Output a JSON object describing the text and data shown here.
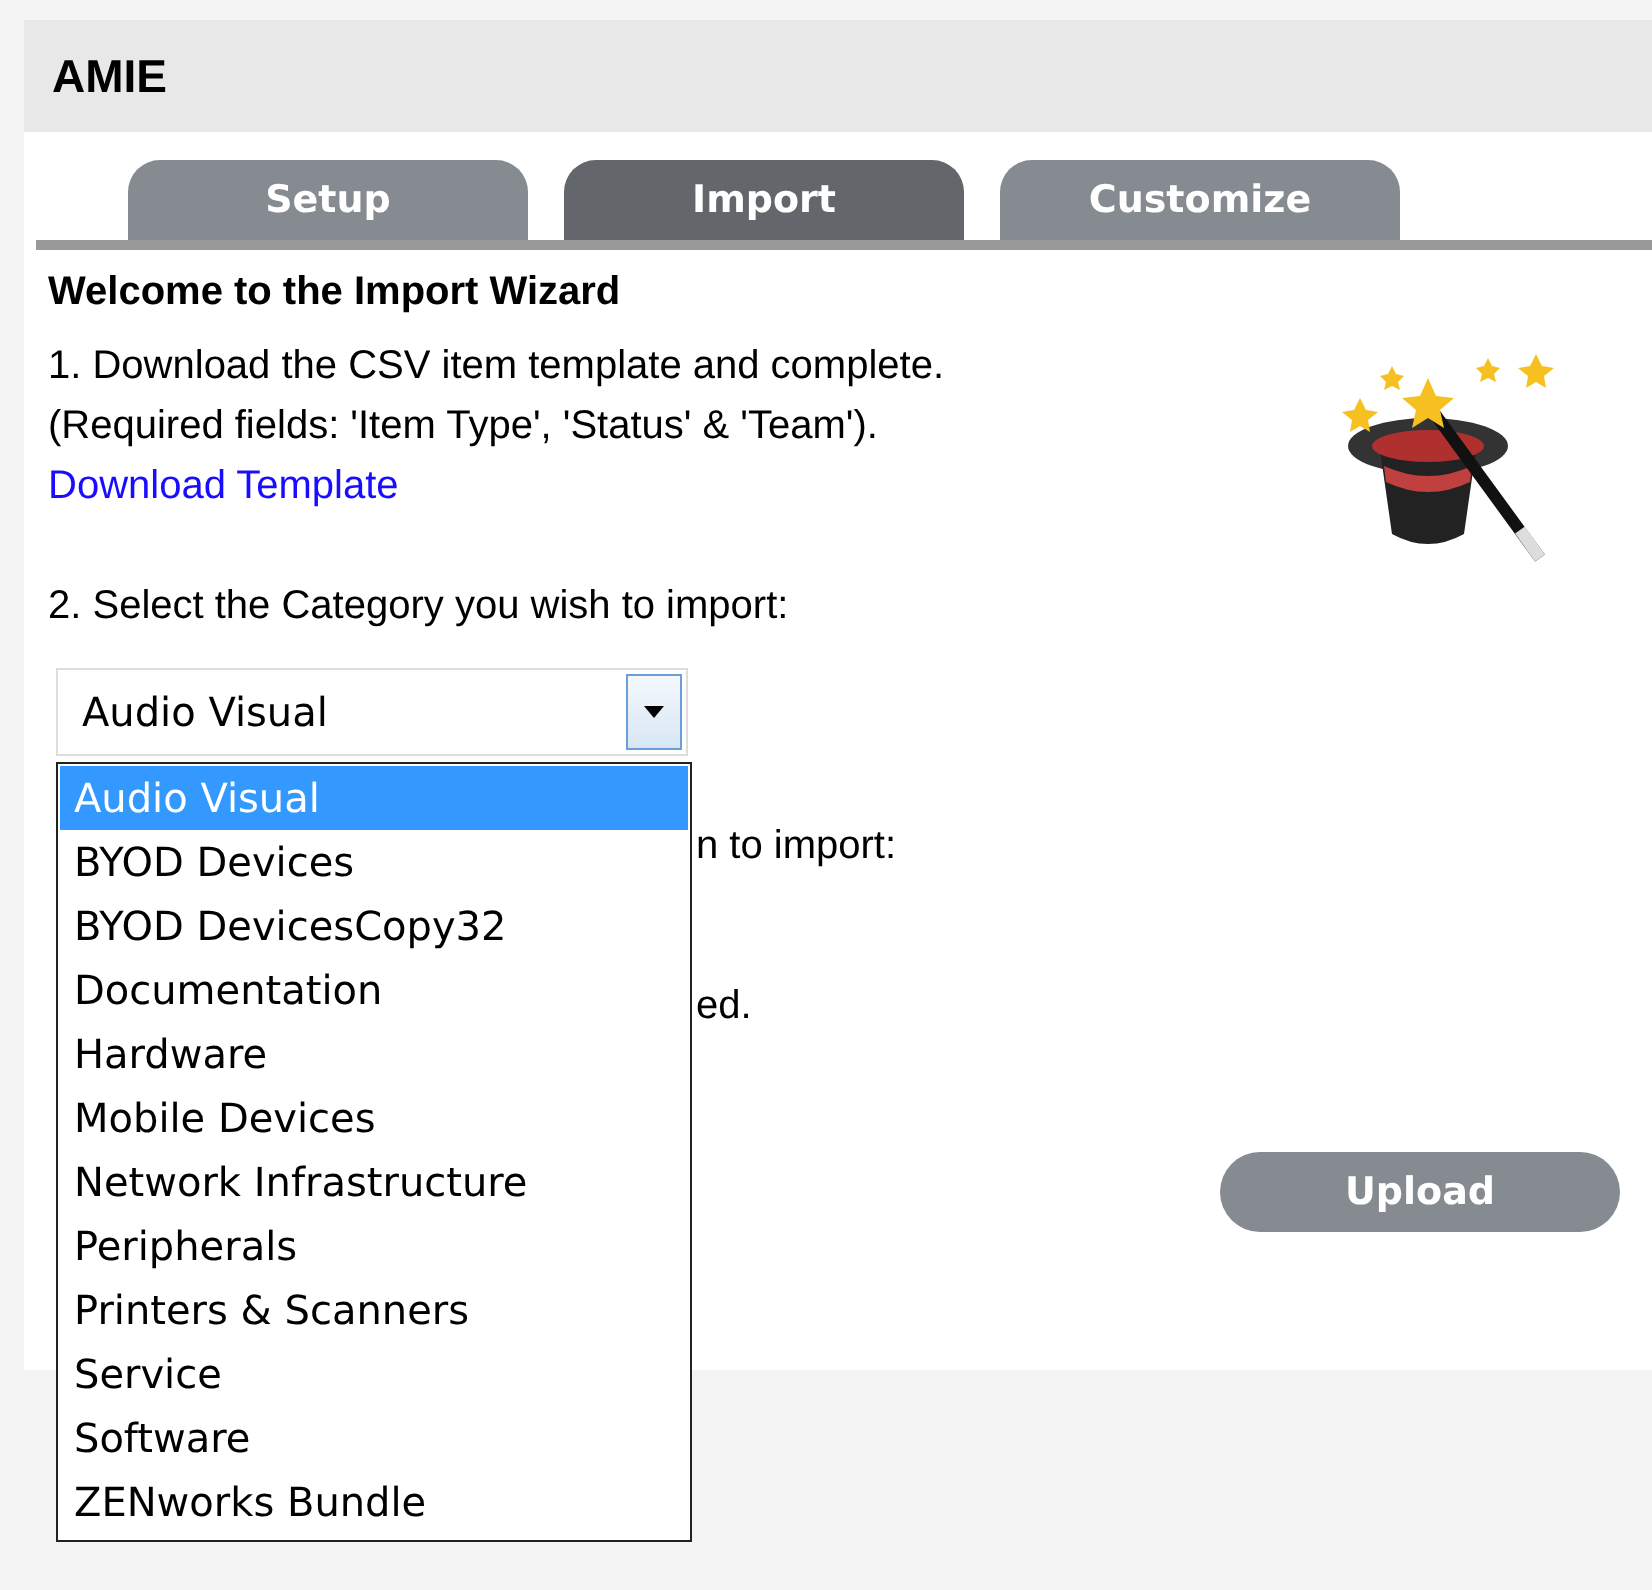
{
  "header": {
    "title": "AMIE"
  },
  "tabs": [
    {
      "label": "Setup",
      "selected": false
    },
    {
      "label": "Import",
      "selected": true
    },
    {
      "label": "Customize",
      "selected": false
    }
  ],
  "wizard": {
    "heading": "Welcome to the Import Wizard",
    "step1_line1": "1. Download the CSV item template and complete.",
    "step1_line2": "(Required fields: 'Item Type', 'Status' & 'Team').",
    "download_link": "Download Template",
    "step2": "2. Select the Category you wish to import:",
    "hidden_line_1": "n to import:",
    "hidden_line_2": "ed."
  },
  "category_select": {
    "value": "Audio Visual",
    "expanded": true,
    "options": [
      {
        "label": "Audio Visual",
        "selected": true
      },
      {
        "label": "BYOD Devices",
        "selected": false
      },
      {
        "label": "BYOD DevicesCopy32",
        "selected": false
      },
      {
        "label": "Documentation",
        "selected": false
      },
      {
        "label": "Hardware",
        "selected": false
      },
      {
        "label": "Mobile Devices",
        "selected": false
      },
      {
        "label": "Network Infrastructure",
        "selected": false
      },
      {
        "label": "Peripherals",
        "selected": false
      },
      {
        "label": "Printers & Scanners",
        "selected": false
      },
      {
        "label": "Service",
        "selected": false
      },
      {
        "label": "Software",
        "selected": false
      },
      {
        "label": "ZENworks Bundle",
        "selected": false
      }
    ]
  },
  "upload_button": "Upload"
}
